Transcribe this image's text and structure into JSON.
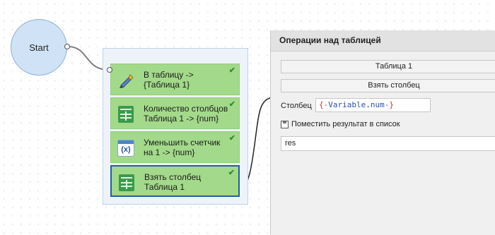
{
  "canvas": {
    "start_label": "Start",
    "actions": [
      {
        "label": "В таблицу ->\n{Таблица 1}",
        "icon": "pen-icon",
        "checked": "✔"
      },
      {
        "label": "Количество столбцов\nТаблица 1 -> {num}",
        "icon": "sheet-icon",
        "checked": "✔"
      },
      {
        "label": "Уменьшить счетчик\nна 1 -> {num}",
        "icon": "variable-icon",
        "checked": "✔"
      },
      {
        "label": "Взять столбец\nТаблица 1",
        "icon": "sheet-icon",
        "checked": "✔"
      }
    ]
  },
  "panel": {
    "title": "Операции над таблицей",
    "table_button": "Таблица 1",
    "operation_button": "Взять столбец",
    "column_label": "Столбец",
    "column_value": {
      "open": "{-",
      "name": "Variable",
      "dot": ".",
      "field": "num",
      "close": "-}"
    },
    "save_to_list_label": "Поместить результат в список",
    "result_value": "res"
  },
  "colors": {
    "action_green": "#a3d98a",
    "selected_border": "#1f5fa8",
    "start_fill": "#d0e3f6",
    "check_green": "#2f8f2f"
  }
}
